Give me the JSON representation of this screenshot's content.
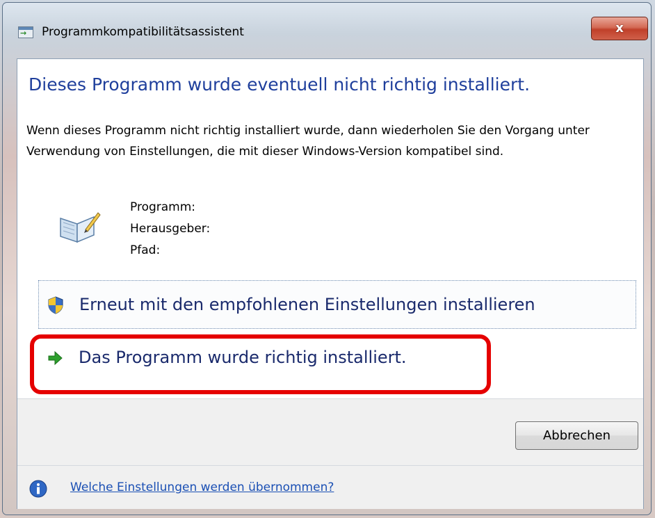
{
  "window": {
    "title": "Programmkompatibilitätsassistent",
    "close_label": "x"
  },
  "content": {
    "heading": "Dieses Programm wurde eventuell nicht richtig installiert.",
    "description": "Wenn dieses Programm nicht richtig installiert wurde, dann wiederholen Sie den Vorgang unter Verwendung von Einstellungen, die mit dieser Windows-Version kompatibel sind.",
    "info_labels": [
      "Programm:",
      "Herausgeber:",
      "Pfad:"
    ]
  },
  "options": [
    {
      "label": "Erneut mit den empfohlenen Einstellungen installieren",
      "icon": "uac-shield-icon"
    },
    {
      "label": "Das Programm wurde richtig installiert.",
      "icon": "green-arrow-icon"
    }
  ],
  "footer": {
    "cancel_label": "Abbrechen",
    "help_link": "Welche Einstellungen werden übernommen?"
  },
  "colors": {
    "heading": "#1f3f9c",
    "highlight": "#e50000",
    "link": "#1a4fb4"
  }
}
